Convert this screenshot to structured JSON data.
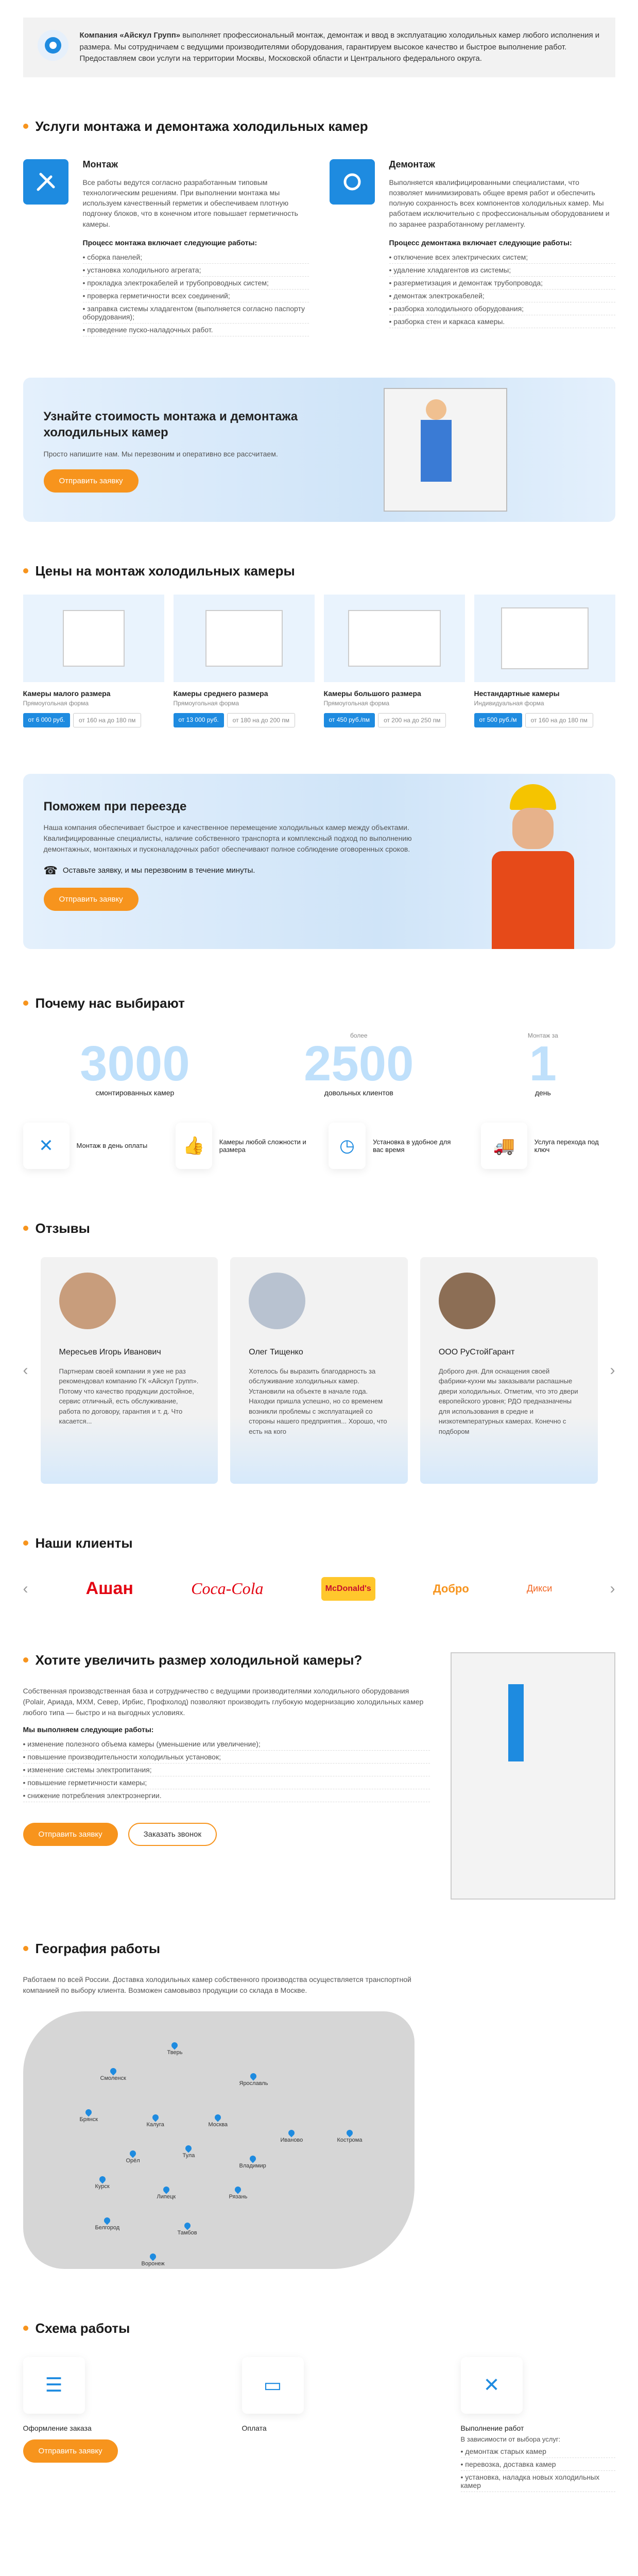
{
  "intro": {
    "company": "Компания «Айскул Групп»",
    "text": " выполняет профессиональный монтаж, демонтаж и ввод в эксплуатацию холодильных камер любого исполнения и размера. Мы сотрудничаем с ведущими производителями оборудования, гарантируем высокое качество и быстрое выполнение работ. Предоставляем свои услуги на территории Москвы, Московской области и Центрального федерального округа."
  },
  "services": {
    "title": "Услуги монтажа и демонтажа холодильных камер",
    "mount": {
      "title": "Монтаж",
      "desc": "Все работы ведутся согласно разработанным типовым технологическим решениям. При выполнении монтажа мы используем качественный герметик и обеспечиваем плотную подгонку блоков, что в конечном итоге повышает герметичность камеры.",
      "sub": "Процесс монтажа включает следующие работы:",
      "items": [
        "сборка панелей;",
        "установка холодильного агрегата;",
        "прокладка электрокабелей и трубопроводных систем;",
        "проверка герметичности всех соединений;",
        "заправка системы хладагентом (выполняется согласно паспорту оборудования);",
        "проведение пуско-наладочных работ."
      ]
    },
    "dismount": {
      "title": "Демонтаж",
      "desc": "Выполняется квалифицированными специалистами, что позволяет минимизировать общее время работ и обеспечить полную сохранность всех компонентов холодильных камер. Мы работаем исключительно с профессиональным оборудованием и по заранее разработанному регламенту.",
      "sub": "Процесс демонтажа включает следующие работы:",
      "items": [
        "отключение всех электрических систем;",
        "удаление хладагентов из системы;",
        "разгерметизация и демонтаж трубопровода;",
        "демонтаж электрокабелей;",
        "разборка холодильного оборудования;",
        "разборка стен и каркаса камеры."
      ]
    }
  },
  "cost": {
    "title": "Узнайте стоимость монтажа и демонтажа холодильных камер",
    "sub": "Просто напишите нам. Мы перезвоним и оперативно все рассчитаем.",
    "btn": "Отправить заявку"
  },
  "prices": {
    "title": "Цены на монтаж холодильных камеры",
    "cards": [
      {
        "name": "Камеры малого размера",
        "form": "Прямоугольная форма",
        "price": "от 6 000 руб.",
        "size": "от 160 на до 180 пм"
      },
      {
        "name": "Камеры среднего размера",
        "form": "Прямоугольная форма",
        "price": "от 13 000 руб.",
        "size": "от 180 на до 200 пм"
      },
      {
        "name": "Камеры большого размера",
        "form": "Прямоугольная форма",
        "price": "от 450 руб./пм",
        "size": "от 200 на до 250 пм"
      },
      {
        "name": "Нестандартные камеры",
        "form": "Индивидуальная форма",
        "price": "от 500 руб./м",
        "size": "от 160 на до 180 пм"
      }
    ]
  },
  "move": {
    "title": "Поможем при переезде",
    "text": "Наша компания обеспечивает быстрое и качественное перемещение холодильных камер между объектами. Квалифицированные специалисты, наличие собственного транспорта и комплексный подход по выполнению демонтажных, монтажных и пусконаладочных работ обеспечивают полное соблюдение оговоренных сроков.",
    "call": "Оставьте заявку, и мы перезвоним в течение минуты.",
    "btn": "Отправить заявку"
  },
  "why": {
    "title": "Почему нас выбирают",
    "stats": [
      {
        "pre": "",
        "num": "3000",
        "label": "смонтированных камер"
      },
      {
        "pre": "более",
        "num": "2500",
        "label": "довольных клиентов"
      },
      {
        "pre": "Монтаж за",
        "num": "1",
        "label": "день"
      }
    ],
    "feats": [
      "Монтаж в день оплаты",
      "Камеры любой сложности и размера",
      "Установка в удобное для вас время",
      "Услуга перехода под ключ"
    ]
  },
  "reviews": {
    "title": "Отзывы",
    "items": [
      {
        "name": "Мересьев Игорь Иванович",
        "text": "Партнерам своей компании я уже не раз рекомендовал компанию ГК «Айскул Групп». Потому что качество продукции достойное, сервис отличный, есть обслуживание, работа по договору, гарантия и т. д. Что касается..."
      },
      {
        "name": "Олег Тищенко",
        "text": "Хотелось бы выразить благодарность за обслуживание холодильных камер. Установили на объекте в начале года. Находки пришла успешно, но со временем возникли проблемы с эксплуатацией со стороны нашего предприятия... Хорошо, что есть на кого"
      },
      {
        "name": "ООО РуСтойГарант",
        "text": "Доброго дня. Для оснащения своей фабрики-кухни мы заказывали распашные двери холодильных. Отметим, что это двери европейского уровня; РДО предназначены для использования в средне и низкотемпературных камерах. Конечно с подбором"
      }
    ]
  },
  "clients": {
    "title": "Наши клиенты",
    "logos": [
      "Ашан",
      "Coca-Cola",
      "McDonald's",
      "Добро",
      "Дикси"
    ]
  },
  "enlarge": {
    "title": "Хотите увеличить размер холодильной камеры?",
    "text": "Собственная производственная база и сотрудничество с ведущими производителями холодильного оборудования (Polair, Ариада, МХМ, Север, Ирбис, Профхолод) позволяют производить глубокую модернизацию холодильных камер любого типа — быстро и на выгодных условиях.",
    "sub": "Мы выполняем следующие работы:",
    "items": [
      "изменение полезного объема камеры (уменьшение или увеличение);",
      "повышение производительности холодильных установок;",
      "изменение системы электропитания;",
      "повышение герметичности камеры;",
      "снижение потребления электроэнергии."
    ],
    "btn1": "Отправить заявку",
    "btn2": "Заказать звонок"
  },
  "geo": {
    "title": "География работы",
    "text": "Работаем по всей России. Доставка холодильных камер собственного производства осуществляется транспортной компанией по выбору клиента. Возможен самовывоз продукции со склада в Москве.",
    "cities": [
      "Тверь",
      "Смоленск",
      "Ярославль",
      "Брянск",
      "Калуга",
      "Москва",
      "Иваново",
      "Кострома",
      "Орёл",
      "Тула",
      "Владимир",
      "Курск",
      "Липецк",
      "Рязань",
      "Белгород",
      "Тамбов",
      "Воронеж"
    ]
  },
  "scheme": {
    "title": "Схема работы",
    "steps": [
      {
        "label": "Оформление заказа",
        "items": []
      },
      {
        "label": "Оплата",
        "items": []
      },
      {
        "label": "Выполнение работ",
        "sub": "В зависимости от выбора услуг:",
        "items": [
          "демонтаж старых камер",
          "перевозка, доставка камер",
          "установка, наладка новых холодильных камер"
        ]
      }
    ],
    "btn": "Отправить заявку"
  }
}
